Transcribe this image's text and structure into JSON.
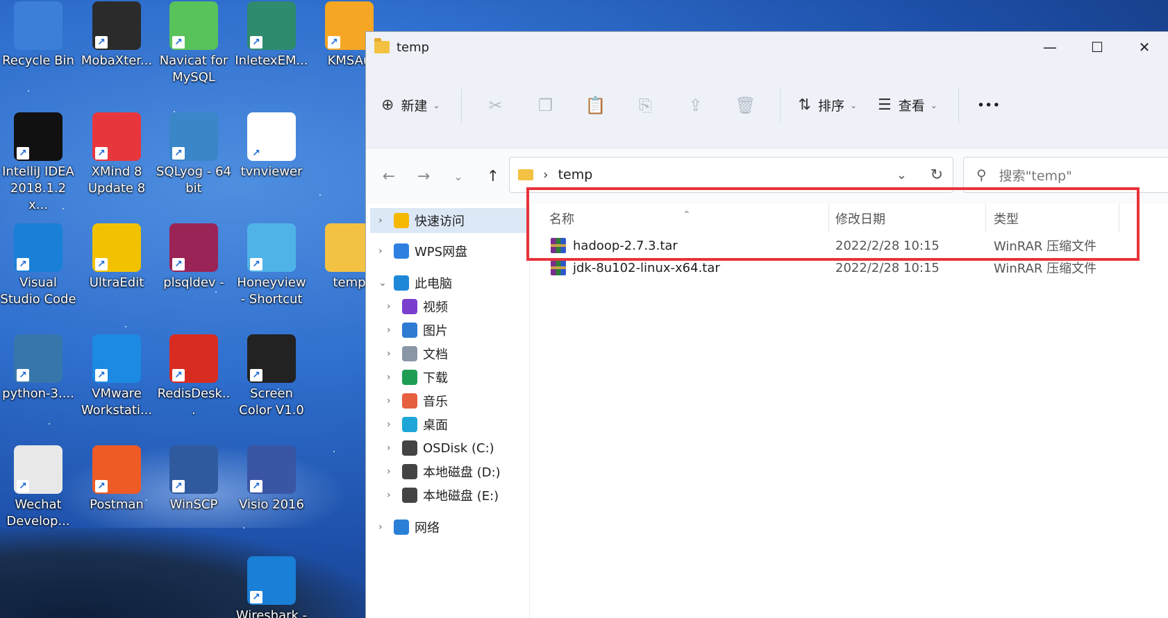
{
  "desktop": {
    "icons": [
      {
        "label": "Recycle Bin",
        "icon": "recycle-bin-icon",
        "color": "#3c7fd8"
      },
      {
        "label": "MobaXter...",
        "icon": "mobaxterm-icon",
        "color": "#2b2b2b"
      },
      {
        "label": "Navicat for MySQL",
        "icon": "navicat-icon",
        "color": "#58c25b"
      },
      {
        "label": "InletexEM...",
        "icon": "inletex-icon",
        "color": "#2e8b6e"
      },
      {
        "label": "KMSAu",
        "icon": "kmsauto-icon",
        "color": "#f5a623"
      },
      {
        "label": "IntelliJ IDEA 2018.1.2 x...",
        "icon": "intellij-icon",
        "color": "#111111"
      },
      {
        "label": "XMind 8 Update 8",
        "icon": "xmind-icon",
        "color": "#e8363d"
      },
      {
        "label": "SQLyog - 64 bit",
        "icon": "sqlyog-icon",
        "color": "#3a86c8"
      },
      {
        "label": "tvnviewer",
        "icon": "vnc-icon",
        "color": "#ffffff"
      },
      {
        "label": "Visual Studio Code",
        "icon": "vscode-icon",
        "color": "#1a7fd6"
      },
      {
        "label": "UltraEdit",
        "icon": "ultraedit-icon",
        "color": "#f2c200"
      },
      {
        "label": "plsqldev -",
        "icon": "plsqldev-icon",
        "color": "#9a2455"
      },
      {
        "label": "Honeyview - Shortcut",
        "icon": "honeyview-icon",
        "color": "#4fb3e8"
      },
      {
        "label": "temp",
        "icon": "folder-icon",
        "color": "#f3c243"
      },
      {
        "label": "python-3....",
        "icon": "python-installer-icon",
        "color": "#3776ab"
      },
      {
        "label": "VMware Workstati...",
        "icon": "vmware-icon",
        "color": "#1c8ae3"
      },
      {
        "label": "RedisDesk...",
        "icon": "redis-icon",
        "color": "#d82c20"
      },
      {
        "label": "Screen Color V1.0",
        "icon": "screen-color-icon",
        "color": "#222222"
      },
      {
        "label": "Wechat Develop...",
        "icon": "wechat-devtools-icon",
        "color": "#e8e8e8"
      },
      {
        "label": "Postman",
        "icon": "postman-icon",
        "color": "#ef5b25"
      },
      {
        "label": "WinSCP",
        "icon": "winscp-icon",
        "color": "#2f5a9e"
      },
      {
        "label": "Visio 2016",
        "icon": "visio-icon",
        "color": "#3955a3"
      },
      {
        "label": "Wireshark -",
        "icon": "wireshark-icon",
        "color": "#1a7fd6"
      }
    ]
  },
  "window": {
    "title": "temp",
    "controls": {
      "minimize": "—",
      "maximize": "☐",
      "close": "✕"
    },
    "toolbar": {
      "new_label": "新建",
      "sort_label": "排序",
      "view_label": "查看",
      "more_label": "•••"
    },
    "address": {
      "crumb": "temp"
    },
    "search": {
      "placeholder": "搜索\"temp\""
    },
    "sidebar": {
      "items": [
        {
          "label": "快速访问",
          "icon": "star-icon",
          "color": "#f5b800"
        },
        {
          "label": "WPS网盘",
          "icon": "cloud-icon",
          "color": "#2f7fe0"
        },
        {
          "label": "此电脑",
          "icon": "computer-icon",
          "color": "#1e88d8"
        },
        {
          "label": "视频",
          "icon": "video-icon",
          "color": "#7a3fcf"
        },
        {
          "label": "图片",
          "icon": "pictures-icon",
          "color": "#2d7bd3"
        },
        {
          "label": "文档",
          "icon": "documents-icon",
          "color": "#8a96a6"
        },
        {
          "label": "下载",
          "icon": "download-icon",
          "color": "#1f9d55"
        },
        {
          "label": "音乐",
          "icon": "music-icon",
          "color": "#e6603f"
        },
        {
          "label": "桌面",
          "icon": "desktop-icon",
          "color": "#1ea6d8"
        },
        {
          "label": "OSDisk (C:)",
          "icon": "os-disk-icon",
          "color": "#444444"
        },
        {
          "label": "本地磁盘 (D:)",
          "icon": "disk-icon",
          "color": "#444444"
        },
        {
          "label": "本地磁盘 (E:)",
          "icon": "disk-icon",
          "color": "#444444"
        },
        {
          "label": "网络",
          "icon": "network-icon",
          "color": "#2a7fd6"
        }
      ]
    },
    "columns": {
      "name": "名称",
      "modified": "修改日期",
      "type": "类型"
    },
    "files": [
      {
        "name": "hadoop-2.7.3.tar",
        "modified": "2022/2/28 10:15",
        "type": "WinRAR 压缩文件"
      },
      {
        "name": "jdk-8u102-linux-x64.tar",
        "modified": "2022/2/28 10:15",
        "type": "WinRAR 压缩文件"
      }
    ],
    "highlight_color": "#e8333b"
  }
}
